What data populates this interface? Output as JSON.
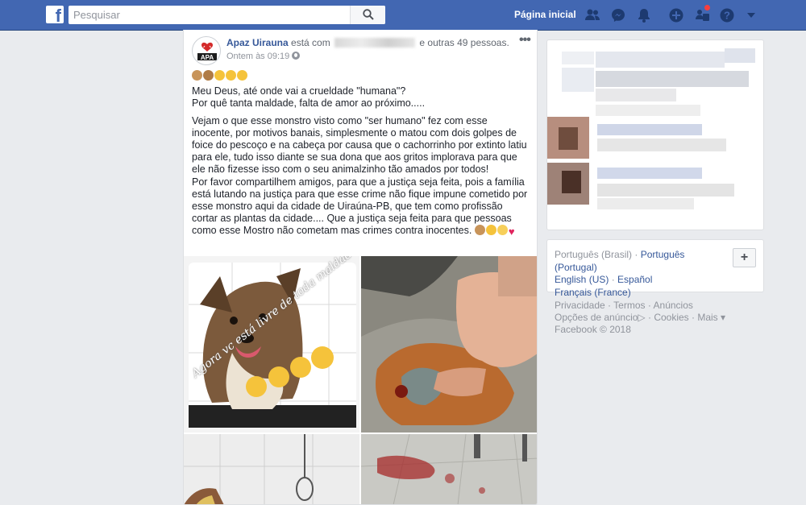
{
  "topbar": {
    "search_placeholder": "Pesquisar",
    "home_label": "Página inicial",
    "icons": [
      "friends-icon",
      "messenger-icon",
      "notifications-icon",
      "create-icon",
      "groups-icon",
      "help-icon",
      "account-menu-icon"
    ],
    "colors": {
      "bar": "#4267b2",
      "badge": "#fa3e3e"
    }
  },
  "post": {
    "page_name": "Apaz Uirauna",
    "with_prefix": "está com",
    "with_suffix": "e outras 49 pessoas.",
    "timestamp": "Ontem às 09:19",
    "paragraph1_line1": "Meu Deus, até onde vai a crueldade \"humana\"?",
    "paragraph1_line2": "Por quê tanta maldade, falta de amor ao próximo.....",
    "paragraph2": "Vejam o que esse monstro visto como \"ser humano\" fez com esse inocente, por motivos banais, simplesmente o matou com dois golpes de foice do pescoço e na cabeça por causa que o cachorrinho por extinto latiu para ele, tudo isso diante se sua dona que aos gritos implorava para que ele não fizesse isso com o seu animalzinho tão amados por todos!",
    "paragraph3": "Por favor compartilhem amigos, para que a justiça seja feita, pois a família está lutando na justiça para que esse crime não fique impune cometido por esse monstro aqui da cidade de Uiraúna-PB, que tem como profissão cortar as plantas da cidade.... Que a justiça seja feita para que pessoas como esse Mostro não cometam mas crimes contra inocentes.",
    "photo1_caption": "Agora vc está livre de toda maldade"
  },
  "right": {
    "languages": {
      "current": "Português (Brasil)",
      "options": [
        "Português (Portugal)",
        "English (US)",
        "Español",
        "Français (France)"
      ],
      "more_label": "+"
    },
    "footer": {
      "links": [
        "Privacidade",
        "Termos",
        "Anúncios",
        "Opções de anúncio",
        "Cookies",
        "Mais"
      ],
      "copyright": "Facebook © 2018"
    }
  }
}
